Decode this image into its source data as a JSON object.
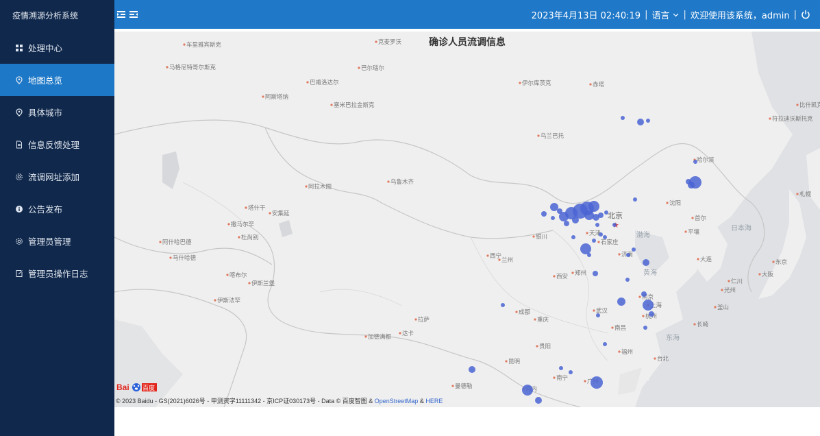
{
  "app": {
    "title": "疫情溯源分析系统"
  },
  "sidebar": {
    "items": [
      {
        "label": "处理中心",
        "icon": "grid-icon",
        "active": false
      },
      {
        "label": "地图总览",
        "icon": "location-pin-icon",
        "active": true
      },
      {
        "label": "具体城市",
        "icon": "location-pin-icon",
        "active": false
      },
      {
        "label": "信息反馈处理",
        "icon": "document-icon",
        "active": false
      },
      {
        "label": "流调网址添加",
        "icon": "gear-icon",
        "active": false
      },
      {
        "label": "公告发布",
        "icon": "info-icon",
        "active": false
      },
      {
        "label": "管理员管理",
        "icon": "gear-icon",
        "active": false
      },
      {
        "label": "管理员操作日志",
        "icon": "edit-icon",
        "active": false
      }
    ]
  },
  "header": {
    "datetime": "2023年4月13日 02:40:19",
    "separator": "|",
    "language_label": "语言",
    "welcome": "欢迎使用该系统，admin",
    "accent_color": "#1f78c8",
    "sidebar_color": "#10284b"
  },
  "map": {
    "title": "确诊人员流调信息",
    "copyright_prefix": "© 2023 Baidu - GS(2021)6026号 - 甲测资字11111342 - 京ICP证030173号 - Data © 百度智图 & ",
    "osm_link": "OpenStreetMap",
    "amp": " & ",
    "here_link": "HERE",
    "logo_text": "Bai 百度",
    "capital_label": "北京",
    "cities": [
      "车里雅宾斯克",
      "克麦罗沃",
      "马格尼特哥尔斯克",
      "巴尔瑙尔",
      "巴甫洛达尔",
      "伊尔库茨克",
      "赤塔",
      "阿斯塔纳",
      "塞米巴拉金斯克",
      "乌兰巴托",
      "哈尔滨",
      "阿拉木图",
      "乌鲁木齐",
      "比什凯克",
      "塔什干",
      "安集延",
      "撒马尔罕",
      "杜尚别",
      "阿什哈巴德",
      "马什哈德",
      "天津",
      "沈阳",
      "石家庄",
      "大连",
      "平壤",
      "首尔",
      "西宁",
      "兰州",
      "银川",
      "济南",
      "喀布尔",
      "伊斯兰堡",
      "西安",
      "郑州",
      "伊斯法罕",
      "拉萨",
      "成都",
      "重庆",
      "武汉",
      "南京",
      "上海",
      "杭州",
      "南昌",
      "贵阳",
      "昆明",
      "南宁",
      "广州",
      "福州",
      "台北",
      "日本海",
      "东海",
      "黄海",
      "渤海",
      "加德满都",
      "达卡",
      "曼德勒",
      "河内",
      "大阪",
      "东京",
      "仁川",
      "光州",
      "釜山",
      "长崎",
      "札幌",
      "符拉迪沃斯托克"
    ],
    "legend_points": [
      {
        "name": "hotspot-north",
        "size": "large"
      }
    ]
  }
}
